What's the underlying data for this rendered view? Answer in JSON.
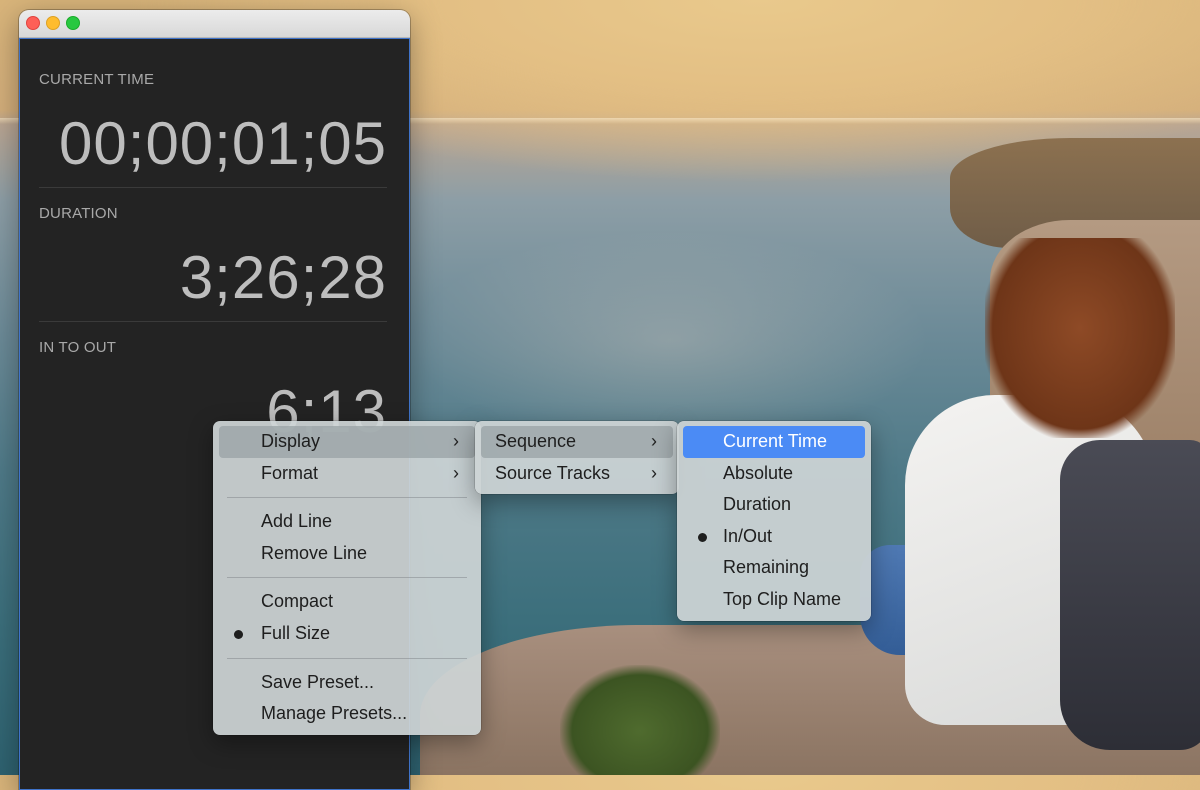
{
  "panel": {
    "sections": [
      {
        "label": "CURRENT TIME",
        "value": "00;00;01;05"
      },
      {
        "label": "DURATION",
        "value": "3;26;28"
      },
      {
        "label": "IN TO OUT",
        "value": "6;13"
      }
    ]
  },
  "menu_main": {
    "items": [
      {
        "label": "Display",
        "submenu": true
      },
      {
        "label": "Format",
        "submenu": true
      },
      {
        "label": "Add Line"
      },
      {
        "label": "Remove Line"
      },
      {
        "label": "Compact"
      },
      {
        "label": "Full Size",
        "checked": true
      },
      {
        "label": "Save Preset..."
      },
      {
        "label": "Manage Presets..."
      }
    ]
  },
  "menu_display": {
    "items": [
      {
        "label": "Sequence",
        "submenu": true
      },
      {
        "label": "Source Tracks",
        "submenu": true
      }
    ]
  },
  "menu_sequence": {
    "items": [
      {
        "label": "Current Time",
        "highlighted": true
      },
      {
        "label": "Absolute"
      },
      {
        "label": "Duration"
      },
      {
        "label": "In/Out",
        "checked": true
      },
      {
        "label": "Remaining"
      },
      {
        "label": "Top Clip Name"
      }
    ]
  },
  "icons": {
    "submenu": "chevron-right-icon",
    "check": "bullet-dot-icon"
  },
  "colors": {
    "highlight": "#4b8bf5",
    "panel_bg": "#232323",
    "panel_border": "#3f73c9"
  }
}
